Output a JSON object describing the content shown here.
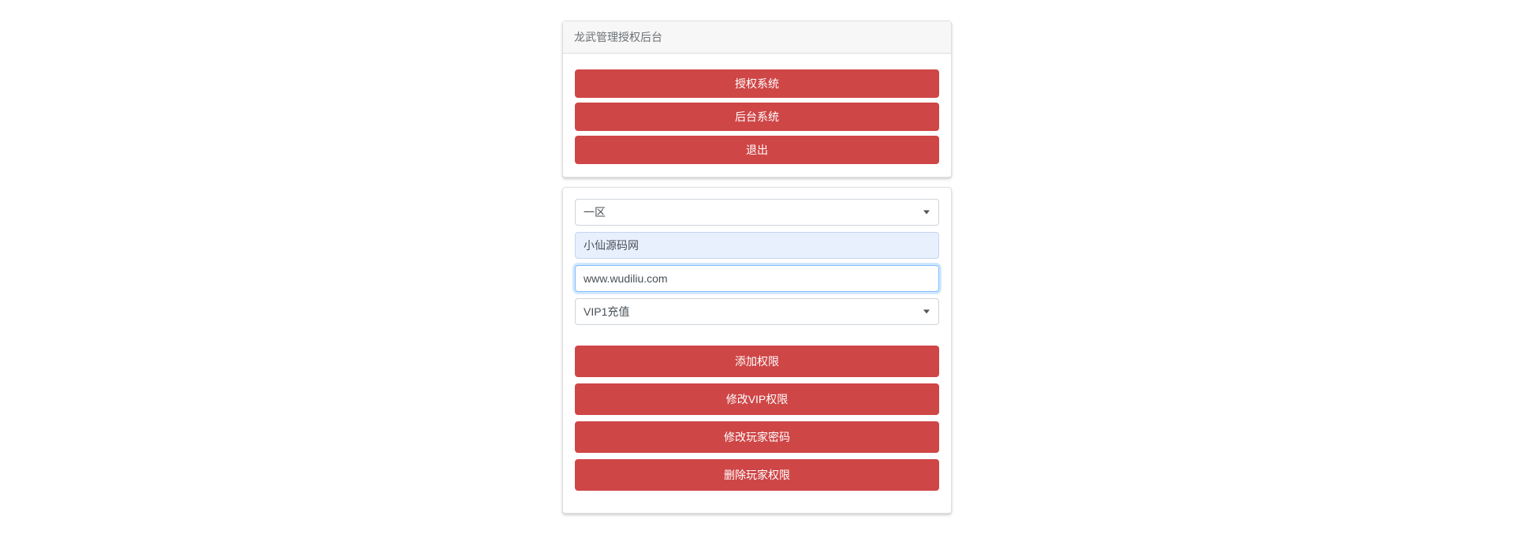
{
  "header": {
    "title": "龙武管理授权后台"
  },
  "nav": {
    "auth_system": "授权系统",
    "backend_system": "后台系统",
    "logout": "退出"
  },
  "form": {
    "zone_selected": "一区",
    "username_value": "小仙源码网",
    "url_value": "www.wudiliu.com",
    "vip_selected": "VIP1充值"
  },
  "actions": {
    "add_permission": "添加权限",
    "modify_vip_permission": "修改VIP权限",
    "modify_player_password": "修改玩家密码",
    "delete_player_permission": "删除玩家权限"
  }
}
